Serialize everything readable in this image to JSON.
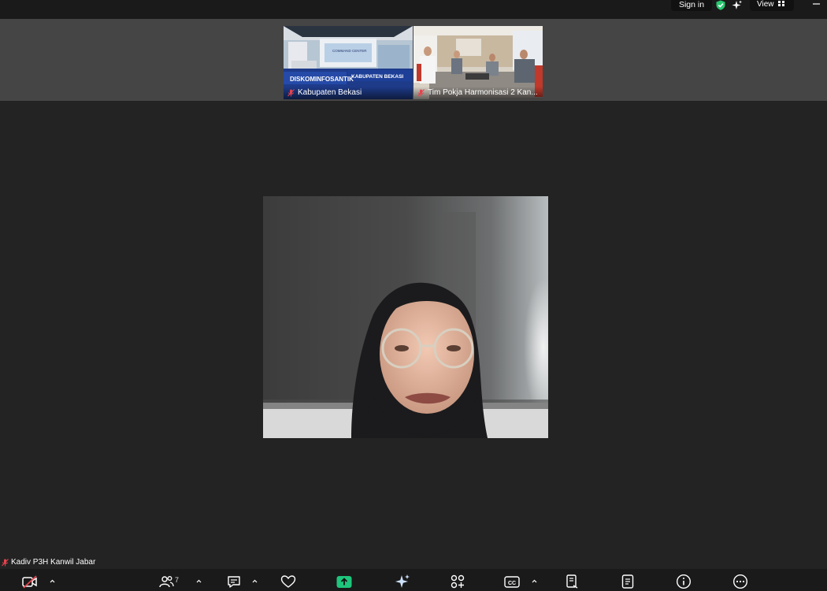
{
  "header": {
    "signin_label": "Sign in",
    "view_label": "View"
  },
  "thumbnails": [
    {
      "name": "Kabupaten Bekasi",
      "sign_left": "DISKOMINFOSANTIK",
      "sign_right": "KABUPATEN BEKASI",
      "sign_top": "COMMAND CENTER"
    },
    {
      "name": "Tim Pokja Harmonisasi 2 Kan..."
    }
  ],
  "active_speaker": {
    "name": "Kadiv P3H Kanwil Jabar"
  },
  "toolbar": {
    "participants_count": "7"
  },
  "colors": {
    "background": "#232323",
    "strip": "#454545",
    "mute_red": "#e8424d",
    "share_green": "#1ec57c",
    "shield_green": "#28c76f"
  }
}
